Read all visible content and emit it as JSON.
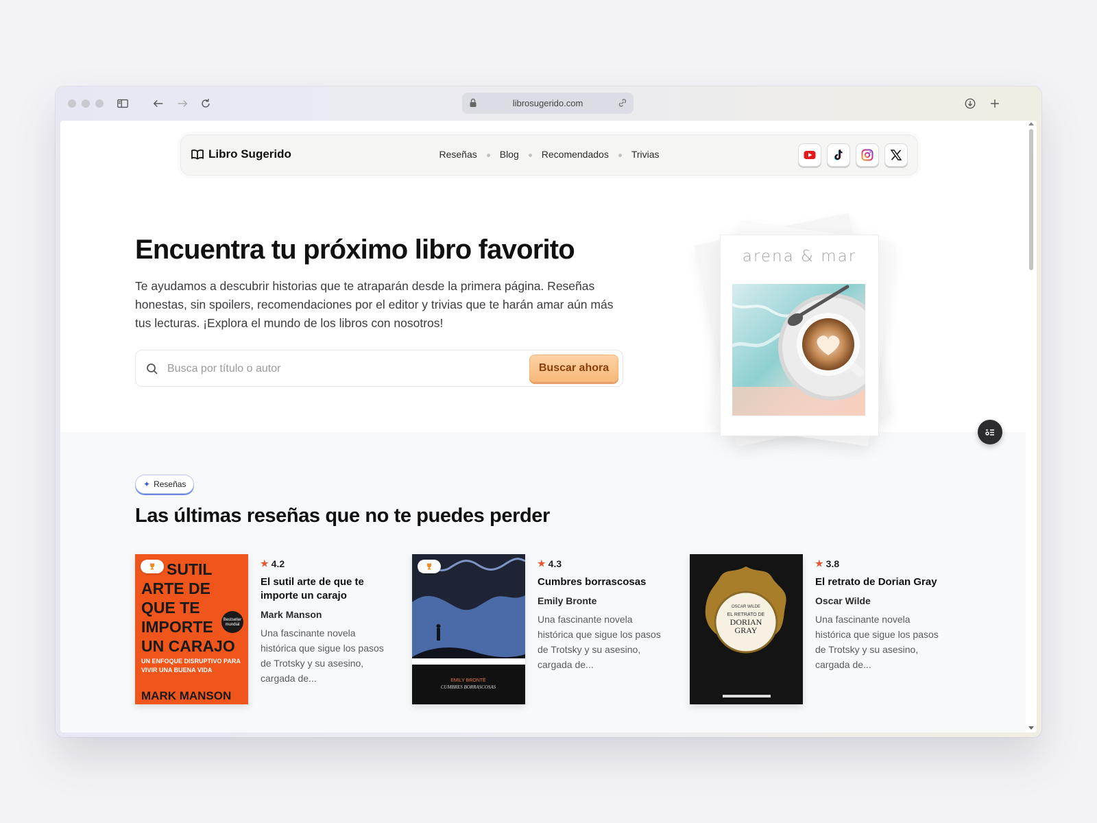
{
  "browser": {
    "url": "librosugerido.com",
    "icons": {
      "sidebar": "sidebar-icon",
      "back": "arrow-left-icon",
      "forward": "arrow-right-icon",
      "reload": "reload-icon",
      "lock": "lock-icon",
      "link": "link-icon",
      "download": "download-icon",
      "new_tab": "plus-icon"
    }
  },
  "nav": {
    "brand": "Libro Sugerido",
    "links": [
      "Reseñas",
      "Blog",
      "Recomendados",
      "Trivias"
    ],
    "socials": [
      "youtube-icon",
      "tiktok-icon",
      "instagram-icon",
      "x-icon"
    ]
  },
  "hero": {
    "title": "Encuentra tu próximo libro favorito",
    "description": "Te ayudamos a descubrir historias que te atraparán desde la primera página. Reseñas honestas, sin spoilers, recomendaciones por el editor y trivias que te harán amar aún más tus lecturas. ¡Explora el mundo de los libros con nosotros!",
    "search_placeholder": "Busca por título o autor",
    "search_button": "Buscar ahora",
    "image_title": "arena & mar"
  },
  "reviews": {
    "tag": "Reseñas",
    "title": "Las últimas reseñas que no te puedes perder",
    "items": [
      {
        "rating": "4.2",
        "title": "El sutil arte de que te importe un carajo",
        "author": "Mark Manson",
        "description": "Una fascinante novela histórica que sigue los pasos de Trotsky y su asesino, cargada de...",
        "cover": {
          "lines": [
            "SUTIL",
            "ARTE DE",
            "QUE TE",
            "IMPORTE",
            "UN CARAJO"
          ],
          "subtitle": "UN ENFOQUE DISRUPTIVO PARA VIVIR UNA BUENA VIDA",
          "author": "MARK MANSON",
          "seal": "Bestseller mundial"
        }
      },
      {
        "rating": "4.3",
        "title": "Cumbres borrascosas",
        "author": "Emily Bronte",
        "description": "Una fascinante novela histórica que sigue los pasos de Trotsky y su asesino, cargada de...",
        "cover": {
          "author": "EMILY BRONTË",
          "title": "CUMBRES BORRASCOSAS"
        }
      },
      {
        "rating": "3.8",
        "title": "El retrato de Dorian Gray",
        "author": "Oscar Wilde",
        "description": "Una fascinante novela histórica que sigue los pasos de Trotsky y su asesino, cargada de...",
        "cover": {
          "author": "OSCAR WILDE",
          "pre": "EL RETRATO DE",
          "title1": "DORIAN",
          "title2": "GRAY"
        }
      }
    ]
  },
  "colors": {
    "accent_orange": "#f9b97a",
    "star": "#e4572e",
    "pill_border": "#6a86e0"
  }
}
